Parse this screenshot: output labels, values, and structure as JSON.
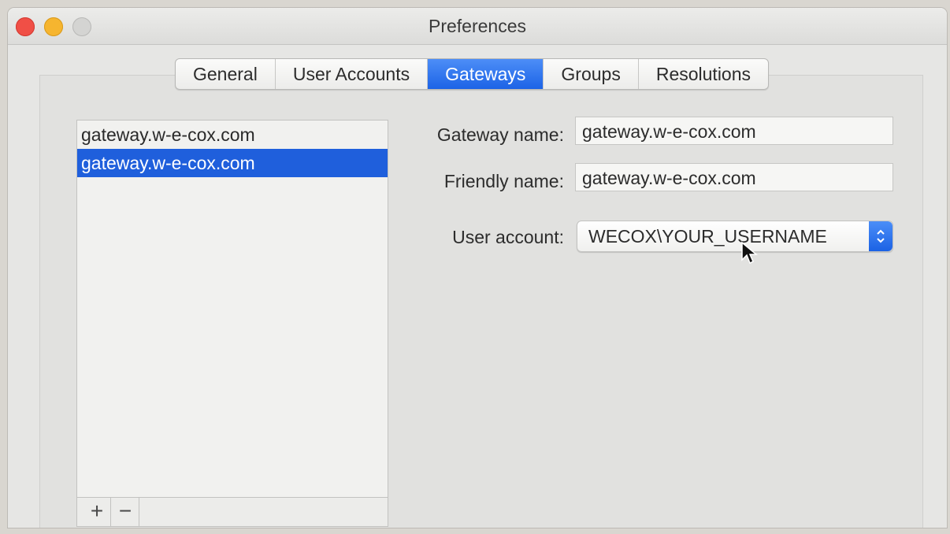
{
  "window": {
    "title": "Preferences"
  },
  "tabs": [
    {
      "label": "General"
    },
    {
      "label": "User Accounts"
    },
    {
      "label": "Gateways",
      "active": true
    },
    {
      "label": "Groups"
    },
    {
      "label": "Resolutions"
    }
  ],
  "gateway_list": {
    "items": [
      "gateway.w-e-cox.com",
      "gateway.w-e-cox.com"
    ],
    "selected_index": 1,
    "add_label": "+",
    "remove_label": "−"
  },
  "form": {
    "gateway_name_label": "Gateway name:",
    "gateway_name_value": "gateway.w-e-cox.com",
    "friendly_name_label": "Friendly name:",
    "friendly_name_value": "gateway.w-e-cox.com",
    "user_account_label": "User account:",
    "user_account_value": "WECOX\\YOUR_USERNAME"
  },
  "icons": {
    "close": "close-button-icon",
    "minimize": "minimize-button-icon",
    "zoom": "zoom-button-icon",
    "popup": "updown-chevron-icon",
    "cursor": "mouse-pointer-icon"
  },
  "colors": {
    "accent": "#1f5fdc",
    "close": "#f04f46",
    "minimize": "#f6b52f"
  }
}
